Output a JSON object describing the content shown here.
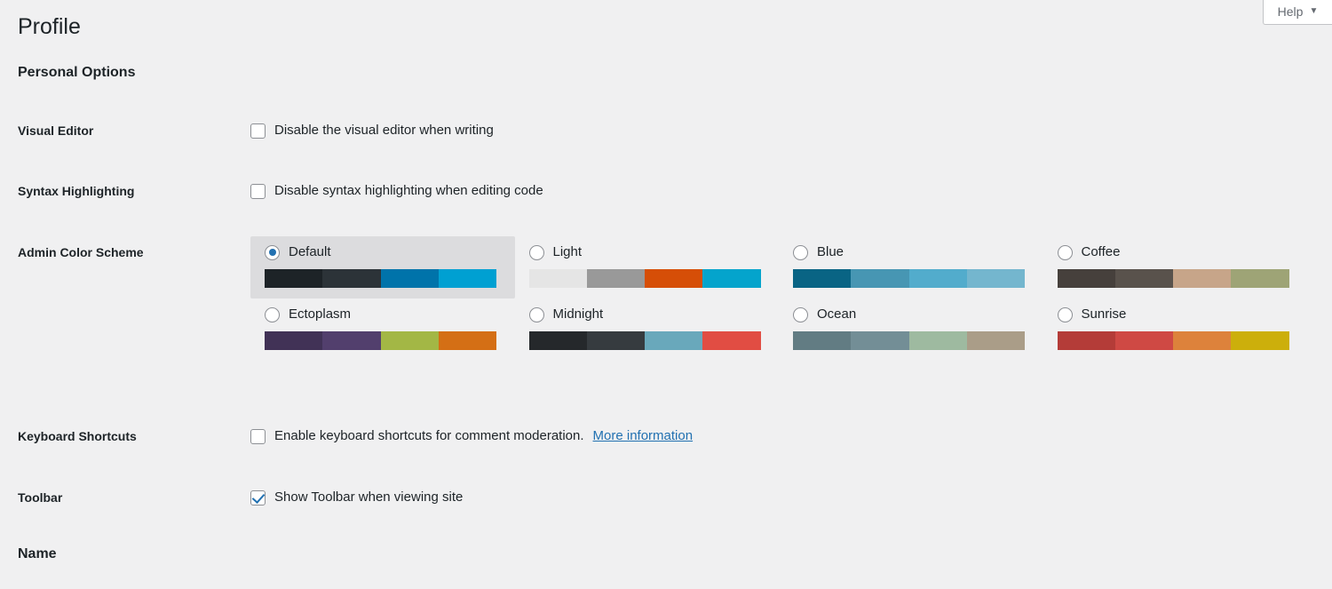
{
  "header": {
    "help_tab_label": "Help",
    "help_tab_caret": "▼"
  },
  "page": {
    "title": "Profile",
    "personal_options_heading": "Personal Options",
    "name_heading": "Name"
  },
  "rows": {
    "visual_editor": {
      "label": "Visual Editor",
      "checkbox_label": "Disable the visual editor when writing",
      "checked": false
    },
    "syntax_highlighting": {
      "label": "Syntax Highlighting",
      "checkbox_label": "Disable syntax highlighting when editing code",
      "checked": false
    },
    "admin_color_scheme": {
      "label": "Admin Color Scheme"
    },
    "keyboard_shortcuts": {
      "label": "Keyboard Shortcuts",
      "checkbox_label": "Enable keyboard shortcuts for comment moderation.",
      "link_label": "More information",
      "checked": false
    },
    "toolbar": {
      "label": "Toolbar",
      "checkbox_label": "Show Toolbar when viewing site",
      "checked": true
    }
  },
  "color_schemes": [
    {
      "id": "default",
      "label": "Default",
      "selected": true,
      "colors": [
        "#1d2327",
        "#2c3338",
        "#0073aa",
        "#00a0d2"
      ]
    },
    {
      "id": "light",
      "label": "Light",
      "selected": false,
      "colors": [
        "#e5e5e5",
        "#999999",
        "#d64e07",
        "#04a4cc"
      ]
    },
    {
      "id": "blue",
      "label": "Blue",
      "selected": false,
      "colors": [
        "#096484",
        "#4796b3",
        "#52accc",
        "#74b6ce"
      ]
    },
    {
      "id": "coffee",
      "label": "Coffee",
      "selected": false,
      "colors": [
        "#46403c",
        "#59524c",
        "#c7a589",
        "#9ea476"
      ]
    },
    {
      "id": "ectoplasm",
      "label": "Ectoplasm",
      "selected": false,
      "colors": [
        "#413256",
        "#523f6d",
        "#a3b745",
        "#d46f15"
      ]
    },
    {
      "id": "midnight",
      "label": "Midnight",
      "selected": false,
      "colors": [
        "#25282b",
        "#363b3f",
        "#69a8bb",
        "#e14d43"
      ]
    },
    {
      "id": "ocean",
      "label": "Ocean",
      "selected": false,
      "colors": [
        "#627c83",
        "#738e96",
        "#9ebaa0",
        "#aa9d88"
      ]
    },
    {
      "id": "sunrise",
      "label": "Sunrise",
      "selected": false,
      "colors": [
        "#b43c38",
        "#cf4944",
        "#dd823b",
        "#ccaf0b"
      ]
    }
  ],
  "theme": {
    "page_background": "#f0f0f1",
    "accent": "#2271b1",
    "selected_scheme_background": "#dcdcde"
  }
}
